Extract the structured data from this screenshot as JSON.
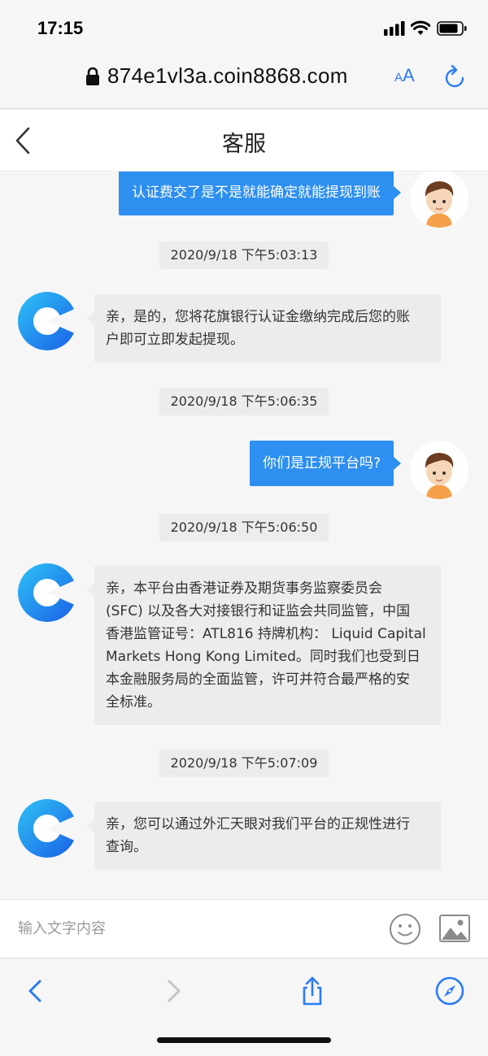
{
  "status_bar": {
    "time": "17:15"
  },
  "browser": {
    "url": "874e1vl3a.coin8868.com",
    "text_size_label_small": "A",
    "text_size_label_large": "A"
  },
  "header": {
    "title": "客服"
  },
  "messages": [
    {
      "type": "outgoing",
      "text": "认证费交了是不是就能确定就能提现到账"
    },
    {
      "type": "timestamp",
      "text": "2020/9/18 下午5:03:13"
    },
    {
      "type": "incoming",
      "lines": [
        "亲，是的，您将花旗银行认证金缴纳完成后您的账",
        "户即可立即发起提现。"
      ]
    },
    {
      "type": "timestamp",
      "text": "2020/9/18 下午5:06:35"
    },
    {
      "type": "outgoing",
      "text": "你们是正规平台吗?"
    },
    {
      "type": "timestamp",
      "text": "2020/9/18 下午5:06:50"
    },
    {
      "type": "incoming",
      "lines": [
        "亲，本平台由香港证券及期货事务监察委员会",
        "(SFC) 以及各大对接银行和证监会共同监管，中国",
        "香港监管证号：ATL816 持牌机构： Liquid Capital",
        "Markets Hong Kong Limited。同时我们也受到日",
        "本金融服务局的全面监管，许可并符合最严格的安",
        "全标准。"
      ]
    },
    {
      "type": "timestamp",
      "text": "2020/9/18 下午5:07:09"
    },
    {
      "type": "incoming",
      "lines": [
        "亲，您可以通过外汇天眼对我们平台的正规性进行",
        "查询。"
      ]
    }
  ],
  "input": {
    "placeholder": "输入文字内容",
    "value": ""
  },
  "icons": {
    "back": "chevron-left-icon",
    "emoji": "smiley-icon",
    "image": "image-icon",
    "lock": "lock-icon",
    "reload": "reload-icon",
    "share": "share-icon",
    "compass": "compass-icon"
  },
  "colors": {
    "accent": "#2d8ff0",
    "browser_blue": "#2a7bf5",
    "bubble_in": "#ececec"
  }
}
